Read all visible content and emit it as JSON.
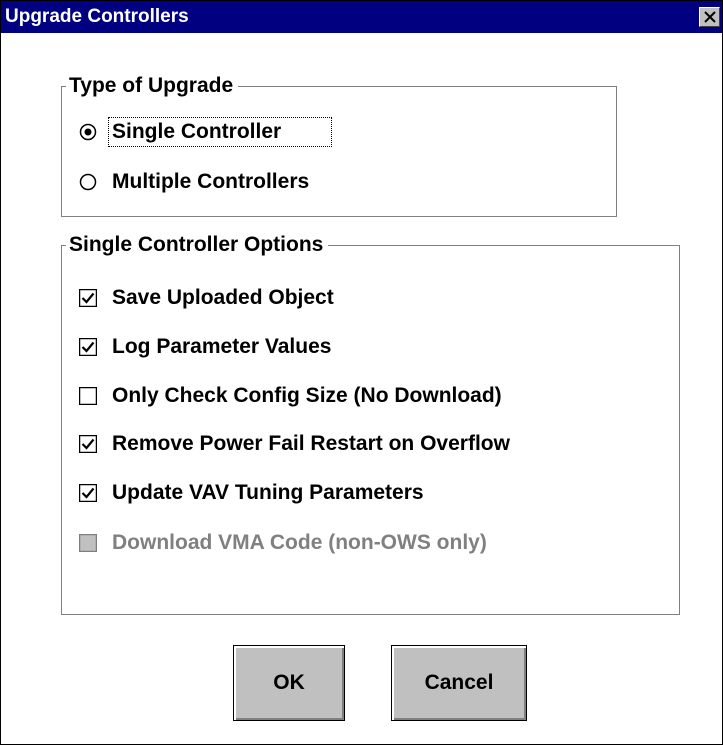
{
  "window": {
    "title": "Upgrade Controllers"
  },
  "type_group": {
    "legend": "Type of Upgrade",
    "options": [
      {
        "label": "Single Controller",
        "selected": true
      },
      {
        "label": "Multiple Controllers",
        "selected": false
      }
    ]
  },
  "options_group": {
    "legend": "Single Controller Options",
    "items": [
      {
        "label": "Save Uploaded Object",
        "checked": true,
        "enabled": true
      },
      {
        "label": "Log Parameter Values",
        "checked": true,
        "enabled": true
      },
      {
        "label": "Only Check Config Size (No Download)",
        "checked": false,
        "enabled": true
      },
      {
        "label": "Remove Power Fail Restart on Overflow",
        "checked": true,
        "enabled": true
      },
      {
        "label": "Update VAV Tuning Parameters",
        "checked": true,
        "enabled": true
      },
      {
        "label": "Download VMA Code (non-OWS only)",
        "checked": false,
        "enabled": false
      }
    ]
  },
  "buttons": {
    "ok": "OK",
    "cancel": "Cancel"
  },
  "colors": {
    "titlebar": "#000080",
    "face": "#c0c0c0",
    "disabled_text": "#808080"
  }
}
